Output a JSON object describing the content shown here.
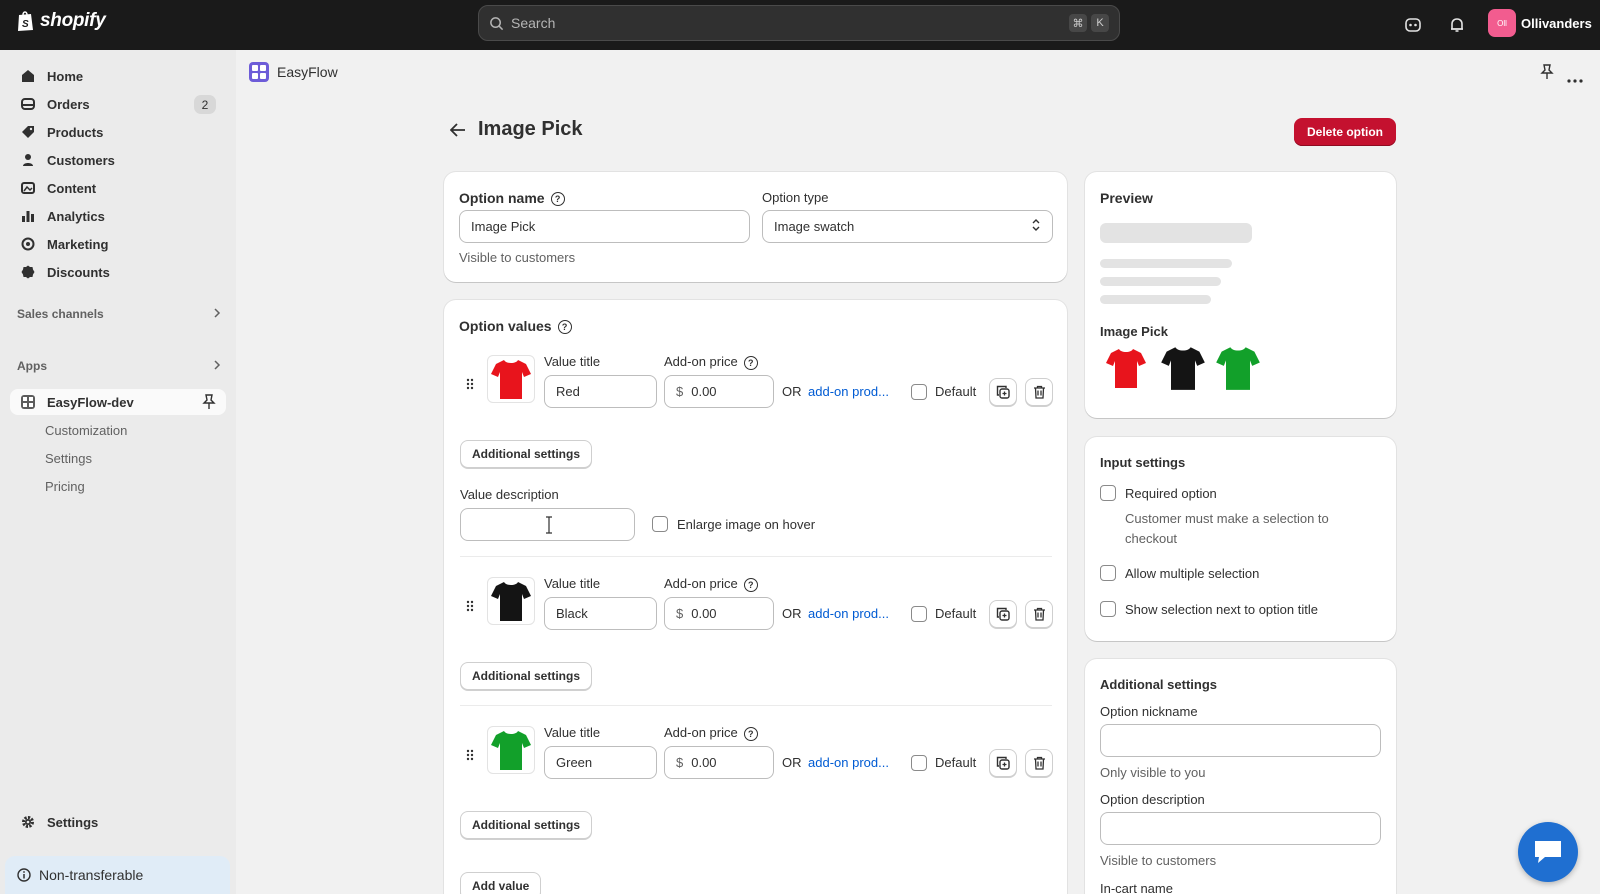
{
  "topbar": {
    "brand": "shopify",
    "search_placeholder": "Search",
    "kbd_cmd": "⌘",
    "kbd_k": "K",
    "store_initials": "Oll",
    "store_name": "Ollivanders"
  },
  "sidebar": {
    "items": [
      {
        "label": "Home",
        "icon": "home-icon"
      },
      {
        "label": "Orders",
        "icon": "orders-icon",
        "badge": "2"
      },
      {
        "label": "Products",
        "icon": "tag-icon"
      },
      {
        "label": "Customers",
        "icon": "person-icon"
      },
      {
        "label": "Content",
        "icon": "content-icon"
      },
      {
        "label": "Analytics",
        "icon": "chart-icon"
      },
      {
        "label": "Marketing",
        "icon": "target-icon"
      },
      {
        "label": "Discounts",
        "icon": "discount-icon"
      }
    ],
    "sales_channels": "Sales channels",
    "apps": "Apps",
    "app_active": "EasyFlow-dev",
    "app_sub": [
      "Customization",
      "Settings",
      "Pricing"
    ],
    "settings": "Settings",
    "non_transferable": "Non-transferable"
  },
  "header": {
    "app_name": "EasyFlow"
  },
  "page": {
    "title": "Image Pick",
    "delete_button": "Delete option"
  },
  "option": {
    "name_label": "Option name",
    "name_value": "Image Pick",
    "name_help": "Visible to customers",
    "type_label": "Option type",
    "type_value": "Image swatch"
  },
  "values": {
    "heading": "Option values",
    "value_title_label": "Value title",
    "addon_price_label": "Add-on price",
    "currency": "$",
    "or": "OR",
    "addon_link": "add-on prod...",
    "default_label": "Default",
    "additional_settings": "Additional settings",
    "value_description_label": "Value description",
    "enlarge_label": "Enlarge image on hover",
    "add_value": "Add value",
    "rows": [
      {
        "title": "Red",
        "price": "0.00",
        "color": "#e8141c"
      },
      {
        "title": "Black",
        "price": "0.00",
        "color": "#141414"
      },
      {
        "title": "Green",
        "price": "0.00",
        "color": "#12a02a"
      }
    ]
  },
  "preview": {
    "heading": "Preview",
    "option_label": "Image Pick",
    "swatches": [
      "#e8141c",
      "#141414",
      "#12a02a"
    ]
  },
  "input_settings": {
    "heading": "Input settings",
    "required": "Required option",
    "required_help": "Customer must make a selection to checkout",
    "multiple": "Allow multiple selection",
    "show_next": "Show selection next to option title"
  },
  "additional": {
    "heading": "Additional settings",
    "nickname_label": "Option nickname",
    "nickname_help": "Only visible to you",
    "description_label": "Option description",
    "description_help": "Visible to customers",
    "incart_label": "In-cart name"
  }
}
